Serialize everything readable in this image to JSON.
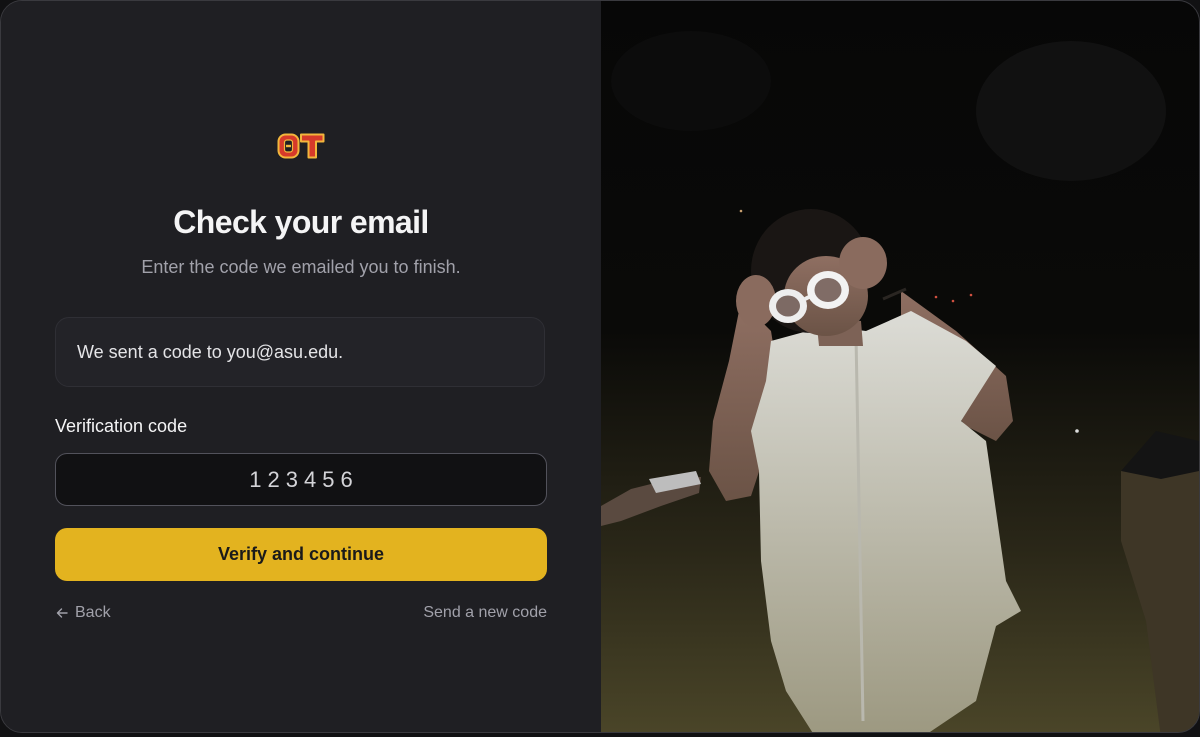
{
  "brand": {
    "logo_text": "ΘT",
    "logo_colors": {
      "fill": "#d63a2a",
      "outline": "#f2b63c"
    }
  },
  "header": {
    "title": "Check your email",
    "subtitle": "Enter the code we emailed you to finish."
  },
  "notice": {
    "text": "We sent a code to you@asu.edu."
  },
  "form": {
    "code_label": "Verification code",
    "code_value": "123456",
    "submit_label": "Verify and continue"
  },
  "footer": {
    "back_label": "Back",
    "resend_label": "Send a new code"
  },
  "colors": {
    "panel_bg": "#1f1f23",
    "accent": "#e3b31f"
  },
  "photo": {
    "subject": "person in white shirt wearing white sunglasses at night"
  }
}
